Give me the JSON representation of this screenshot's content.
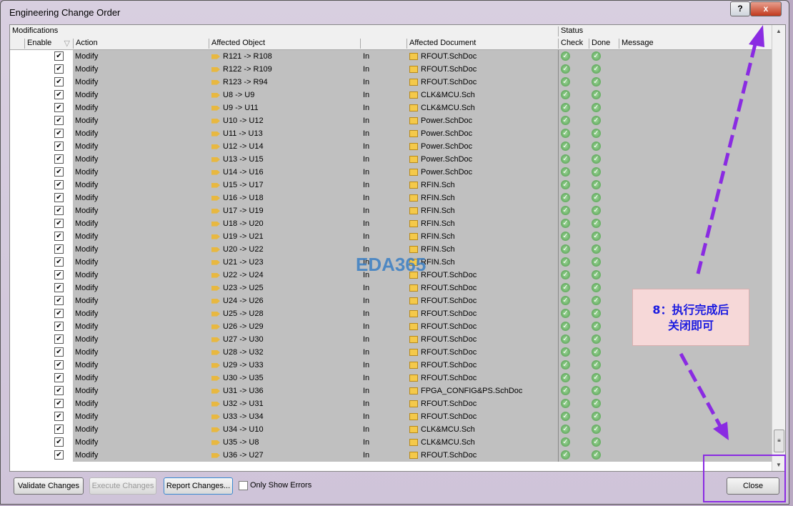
{
  "window": {
    "title": "Engineering Change Order",
    "help": "?",
    "close": "x"
  },
  "grid": {
    "group_modifications": "Modifications",
    "group_status": "Status",
    "columns": {
      "enable": "Enable",
      "action": "Action",
      "object": "Affected Object",
      "document": "Affected Document",
      "check": "Check",
      "done": "Done",
      "message": "Message"
    },
    "rows": [
      [
        "Modify",
        "R121 -> R108",
        "In",
        "RFOUT.SchDoc"
      ],
      [
        "Modify",
        "R122 -> R109",
        "In",
        "RFOUT.SchDoc"
      ],
      [
        "Modify",
        "R123 -> R94",
        "In",
        "RFOUT.SchDoc"
      ],
      [
        "Modify",
        "U8 -> U9",
        "In",
        "CLK&MCU.Sch"
      ],
      [
        "Modify",
        "U9 -> U11",
        "In",
        "CLK&MCU.Sch"
      ],
      [
        "Modify",
        "U10 -> U12",
        "In",
        "Power.SchDoc"
      ],
      [
        "Modify",
        "U11 -> U13",
        "In",
        "Power.SchDoc"
      ],
      [
        "Modify",
        "U12 -> U14",
        "In",
        "Power.SchDoc"
      ],
      [
        "Modify",
        "U13 -> U15",
        "In",
        "Power.SchDoc"
      ],
      [
        "Modify",
        "U14 -> U16",
        "In",
        "Power.SchDoc"
      ],
      [
        "Modify",
        "U15 -> U17",
        "In",
        "RFIN.Sch"
      ],
      [
        "Modify",
        "U16 -> U18",
        "In",
        "RFIN.Sch"
      ],
      [
        "Modify",
        "U17 -> U19",
        "In",
        "RFIN.Sch"
      ],
      [
        "Modify",
        "U18 -> U20",
        "In",
        "RFIN.Sch"
      ],
      [
        "Modify",
        "U19 -> U21",
        "In",
        "RFIN.Sch"
      ],
      [
        "Modify",
        "U20 -> U22",
        "In",
        "RFIN.Sch"
      ],
      [
        "Modify",
        "U21 -> U23",
        "In",
        "RFIN.Sch"
      ],
      [
        "Modify",
        "U22 -> U24",
        "In",
        "RFOUT.SchDoc"
      ],
      [
        "Modify",
        "U23 -> U25",
        "In",
        "RFOUT.SchDoc"
      ],
      [
        "Modify",
        "U24 -> U26",
        "In",
        "RFOUT.SchDoc"
      ],
      [
        "Modify",
        "U25 -> U28",
        "In",
        "RFOUT.SchDoc"
      ],
      [
        "Modify",
        "U26 -> U29",
        "In",
        "RFOUT.SchDoc"
      ],
      [
        "Modify",
        "U27 -> U30",
        "In",
        "RFOUT.SchDoc"
      ],
      [
        "Modify",
        "U28 -> U32",
        "In",
        "RFOUT.SchDoc"
      ],
      [
        "Modify",
        "U29 -> U33",
        "In",
        "RFOUT.SchDoc"
      ],
      [
        "Modify",
        "U30 -> U35",
        "In",
        "RFOUT.SchDoc"
      ],
      [
        "Modify",
        "U31 -> U36",
        "In",
        "FPGA_CONFIG&PS.SchDoc"
      ],
      [
        "Modify",
        "U32 -> U31",
        "In",
        "RFOUT.SchDoc"
      ],
      [
        "Modify",
        "U33 -> U34",
        "In",
        "RFOUT.SchDoc"
      ],
      [
        "Modify",
        "U34 -> U10",
        "In",
        "CLK&MCU.Sch"
      ],
      [
        "Modify",
        "U35 -> U8",
        "In",
        "CLK&MCU.Sch"
      ],
      [
        "Modify",
        "U36 -> U27",
        "In",
        "RFOUT.SchDoc"
      ]
    ]
  },
  "footer": {
    "validate": "Validate Changes",
    "execute": "Execute Changes",
    "report": "Report Changes...",
    "only_errors": "Only Show Errors",
    "close": "Close"
  },
  "annotation": {
    "line1": "8：执行完成后",
    "line2": "关闭即可",
    "color": "#8a2be2"
  },
  "watermark": "EDA365"
}
